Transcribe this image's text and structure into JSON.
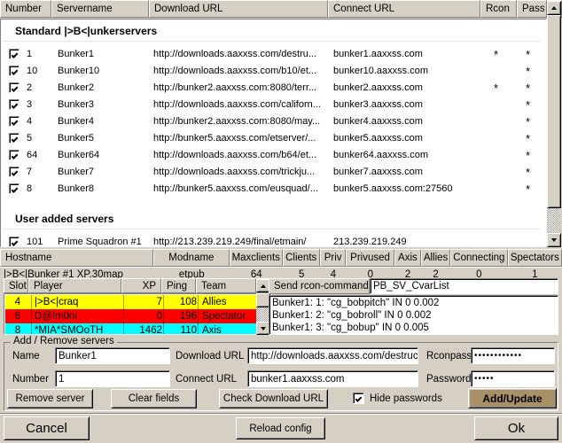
{
  "server_list": {
    "columns": [
      "Number",
      "Servername",
      "Download URL",
      "Connect URL",
      "Rcon",
      "Pass"
    ],
    "groups": [
      {
        "title": "Standard |>B<|unkerservers",
        "rows": [
          {
            "checked": true,
            "number": "1",
            "name": "Bunker1",
            "download_url": "http://downloads.aaxxss.com/destru...",
            "connect_url": "bunker1.aaxxss.com",
            "rcon": "*",
            "pass": "*"
          },
          {
            "checked": true,
            "number": "10",
            "name": "Bunker10",
            "download_url": "http://downloads.aaxxss.com/b10/et...",
            "connect_url": "bunker10.aaxxss.com",
            "rcon": "",
            "pass": "*"
          },
          {
            "checked": true,
            "number": "2",
            "name": "Bunker2",
            "download_url": "http://bunker2.aaxxss.com:8080/terr...",
            "connect_url": "bunker2.aaxxss.com",
            "rcon": "*",
            "pass": "*"
          },
          {
            "checked": true,
            "number": "3",
            "name": "Bunker3",
            "download_url": "http://downloads.aaxxss.com/californ...",
            "connect_url": "bunker3.aaxxss.com",
            "rcon": "",
            "pass": "*"
          },
          {
            "checked": true,
            "number": "4",
            "name": "Bunker4",
            "download_url": "http://bunker2.aaxxss.com:8080/may...",
            "connect_url": "bunker4.aaxxss.com",
            "rcon": "",
            "pass": "*"
          },
          {
            "checked": true,
            "number": "5",
            "name": "Bunker5",
            "download_url": "http://bunker5.aaxxss.com/etserver/...",
            "connect_url": "bunker5.aaxxss.com",
            "rcon": "",
            "pass": "*"
          },
          {
            "checked": true,
            "number": "64",
            "name": "Bunker64",
            "download_url": "http://downloads.aaxxss.com/b64/et...",
            "connect_url": "bunker64.aaxxss.com",
            "rcon": "",
            "pass": "*"
          },
          {
            "checked": true,
            "number": "7",
            "name": "Bunker7",
            "download_url": "http://downloads.aaxxss.com/trickju...",
            "connect_url": "bunker7.aaxxss.com",
            "rcon": "",
            "pass": "*"
          },
          {
            "checked": true,
            "number": "8",
            "name": "Bunker8",
            "download_url": "http://bunker5.aaxxss.com/eusquad/...",
            "connect_url": "bunker5.aaxxss.com:27560",
            "rcon": "",
            "pass": "*"
          }
        ]
      },
      {
        "title": "User added servers",
        "rows": [
          {
            "checked": true,
            "number": "101",
            "name": "Prime Squadron #1",
            "download_url": "http://213.239.219.249/final/etmain/",
            "connect_url": "213.239.219.249",
            "rcon": "",
            "pass": ""
          }
        ]
      }
    ]
  },
  "server_info": {
    "columns": [
      "Hostname",
      "Modname",
      "Maxclients",
      "Clients",
      "Priv",
      "Privused",
      "Axis",
      "Allies",
      "Connecting",
      "Spectators"
    ],
    "values": [
      "|>B<|Bunker #1 XP.30map",
      "etpub",
      "64",
      "5",
      "4",
      "0",
      "2",
      "2",
      "0",
      "1"
    ]
  },
  "players": {
    "columns": [
      "Slot",
      "Player",
      "XP",
      "Ping",
      "Team"
    ],
    "rows": [
      {
        "slot": "4",
        "player": "|>B<|craq",
        "xp": "7",
        "ping": "108",
        "team": "Allies",
        "bg": "#ffff00",
        "fg": "#000000"
      },
      {
        "slot": "6",
        "player": "D@!m0ni",
        "xp": "0",
        "ping": "196",
        "team": "Spectator",
        "bg": "#ff0000",
        "fg": "#000000"
      },
      {
        "slot": "8",
        "player": "*MIA*SMOoTH",
        "xp": "1462",
        "ping": "110",
        "team": "Axis",
        "bg": "#00ffff",
        "fg": "#000000"
      }
    ]
  },
  "rcon": {
    "label": "Send rcon-command:",
    "command": "PB_SV_CvarList",
    "output": [
      "Bunker1: 1: \"cg_bobpitch\" IN 0 0.002",
      "Bunker1: 2: \"cg_bobroll\" IN 0 0.002",
      "Bunker1: 3: \"cg_bobup\" IN 0 0.005"
    ]
  },
  "add_remove": {
    "legend": "Add / Remove servers",
    "name_label": "Name",
    "name_value": "Bunker1",
    "number_label": "Number",
    "number_value": "1",
    "download_url_label": "Download URL",
    "download_url_value": "http://downloads.aaxxss.com/destruct",
    "connect_url_label": "Connect URL",
    "connect_url_value": "bunker1.aaxxss.com",
    "rconpass_label": "Rconpass",
    "rconpass_value": "••••••••••••",
    "password_label": "Password",
    "password_value": "•••••",
    "remove_server_label": "Remove server",
    "clear_fields_label": "Clear fields",
    "check_download_url_label": "Check Download URL",
    "hide_passwords_label": "Hide passwords",
    "hide_passwords_checked": true,
    "add_update_label": "Add/Update",
    "add_update_color": "#a89068"
  },
  "footer": {
    "cancel_label": "Cancel",
    "reload_config_label": "Reload config",
    "ok_label": "Ok"
  }
}
